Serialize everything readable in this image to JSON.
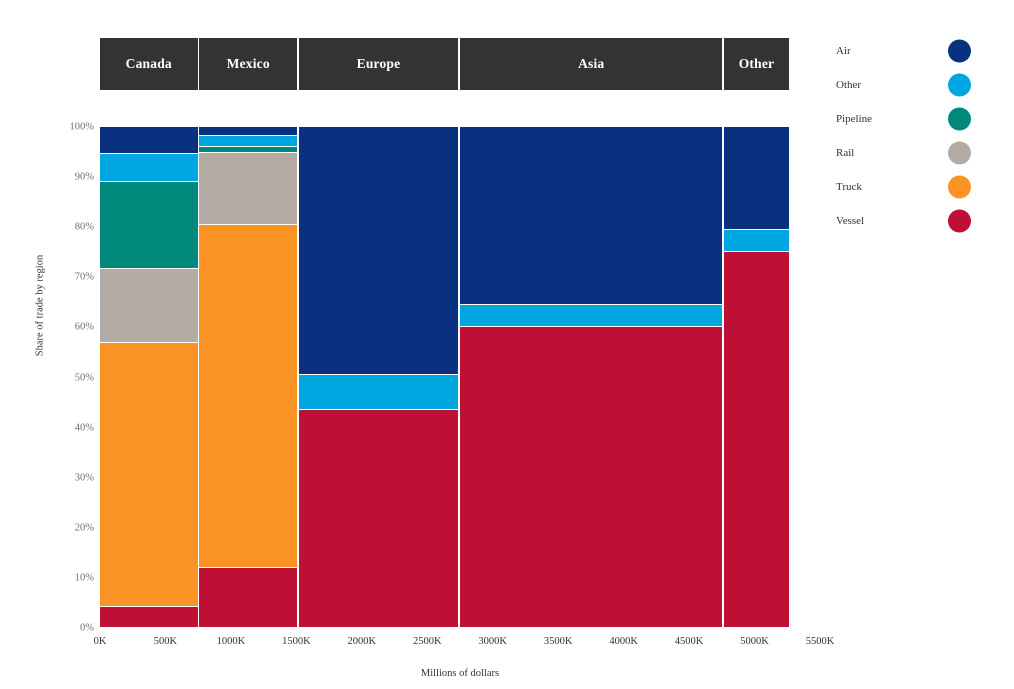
{
  "axes": {
    "y_title": "Share of trade by region",
    "x_title": "Millions of dollars",
    "y_ticks": [
      "0%",
      "10%",
      "20%",
      "30%",
      "40%",
      "50%",
      "60%",
      "70%",
      "80%",
      "90%",
      "100%"
    ],
    "x_ticks": [
      "0K",
      "500K",
      "1000K",
      "1500K",
      "2000K",
      "2500K",
      "3000K",
      "3500K",
      "4000K",
      "4500K",
      "5000K",
      "5500K"
    ]
  },
  "legend": {
    "items": [
      {
        "label": "Air",
        "color": "#0A3080"
      },
      {
        "label": "Other",
        "color": "#00A6E0"
      },
      {
        "label": "Pipeline",
        "color": "#00897B"
      },
      {
        "label": "Rail",
        "color": "#B3ABA4"
      },
      {
        "label": "Truck",
        "color": "#FB9224"
      },
      {
        "label": "Vessel",
        "color": "#BE0F34"
      }
    ]
  },
  "headers": [
    {
      "label": "Canada"
    },
    {
      "label": "Mexico"
    },
    {
      "label": "Europe"
    },
    {
      "label": "Asia"
    },
    {
      "label": "Other"
    }
  ],
  "chart_data": {
    "type": "bar",
    "subtype": "mosaic",
    "title": "",
    "xlabel": "Millions of dollars",
    "ylabel": "Share of trade by region",
    "xlim": [
      0,
      5500
    ],
    "ylim": [
      0,
      100
    ],
    "x_unit": "millions of dollars",
    "y_unit": "percent",
    "grid": false,
    "legend_position": "right",
    "series_names": [
      "Air",
      "Other",
      "Pipeline",
      "Rail",
      "Truck",
      "Vessel"
    ],
    "series_colors": [
      "#0A3080",
      "#00A6E0",
      "#00897B",
      "#B3ABA4",
      "#FB9224",
      "#BE0F34"
    ],
    "categories": [
      "Canada",
      "Mexico",
      "Europe",
      "Asia",
      "Other"
    ],
    "category_widths": [
      745,
      745,
      1215,
      2005,
      490
    ],
    "category_x_ranges": [
      [
        0,
        745
      ],
      [
        760,
        1505
      ],
      [
        1520,
        2735
      ],
      [
        2750,
        4755
      ],
      [
        4770,
        5260
      ]
    ],
    "column_shares": [
      {
        "category": "Canada",
        "values": {
          "Air": 5.4,
          "Other": 5.6,
          "Pipeline": 17.4,
          "Rail": 14.8,
          "Truck": 52.6,
          "Vessel": 4.2
        }
      },
      {
        "category": "Mexico",
        "values": {
          "Air": 1.8,
          "Other": 2.2,
          "Pipeline": 1.2,
          "Rail": 14.3,
          "Truck": 68.6,
          "Vessel": 11.9
        }
      },
      {
        "category": "Europe",
        "values": {
          "Air": 49.6,
          "Other": 6.8,
          "Pipeline": 0,
          "Rail": 0,
          "Truck": 0,
          "Vessel": 43.6
        }
      },
      {
        "category": "Asia",
        "values": {
          "Air": 35.5,
          "Other": 4.4,
          "Pipeline": 0,
          "Rail": 0,
          "Truck": 0,
          "Vessel": 60.1
        }
      },
      {
        "category": "Other",
        "values": {
          "Air": 20.5,
          "Other": 4.5,
          "Pipeline": 0,
          "Rail": 0,
          "Truck": 0,
          "Vessel": 75.0
        }
      }
    ]
  },
  "style": {
    "header_bg": "#333333",
    "header_text": "#ffffff",
    "tick_color": "#6f6f6f",
    "axis_text": "#333333",
    "segment_gap": "#ffffff"
  }
}
